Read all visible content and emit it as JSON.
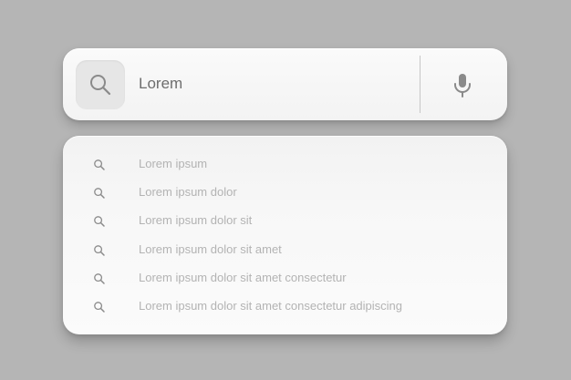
{
  "search": {
    "value": "Lorem",
    "icon": "search-icon",
    "mic_icon": "microphone-icon"
  },
  "suggestions": {
    "icon": "search-icon",
    "items": [
      {
        "label": "Lorem ipsum"
      },
      {
        "label": "Lorem ipsum dolor"
      },
      {
        "label": "Lorem ipsum dolor sit"
      },
      {
        "label": "Lorem ipsum dolor sit amet"
      },
      {
        "label": "Lorem ipsum dolor sit amet consectetur"
      },
      {
        "label": "Lorem ipsum dolor sit amet consectetur adipiscing"
      }
    ]
  },
  "colors": {
    "background": "#b5b5b5",
    "panel": "#f7f7f7",
    "icon_box": "#e6e6e6",
    "input_text": "#6e6e6e",
    "suggestion_text": "#b3b3b3",
    "icon": "#8a8a8a"
  }
}
